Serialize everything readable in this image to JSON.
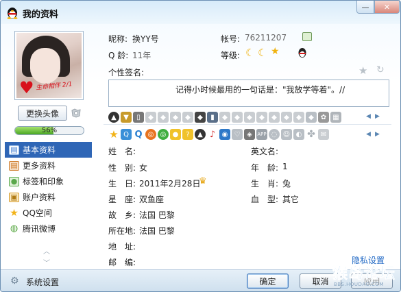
{
  "window": {
    "title": "我的资料",
    "minimize_glyph": "—",
    "close_glyph": "✕"
  },
  "left": {
    "avatar_stamp": "生命相伴 2/1",
    "change_avatar_label": "更换头像",
    "progress": {
      "percent": 56,
      "text": "56%"
    },
    "nav": [
      {
        "label": "基本资料",
        "icon": "profile-card-icon",
        "color": "#3e7bd0"
      },
      {
        "label": "更多资料",
        "icon": "more-info-icon",
        "color": "#d07c2a"
      },
      {
        "label": "标签和印象",
        "icon": "tag-icon",
        "color": "#5aa84b"
      },
      {
        "label": "账户资料",
        "icon": "account-icon",
        "color": "#d59a2a"
      },
      {
        "label": "QQ空间",
        "icon": "qzone-star-icon",
        "color": "#f2b216"
      },
      {
        "label": "腾讯微博",
        "icon": "weibo-icon",
        "color": "#55a63f"
      }
    ],
    "up_glyph": "︿",
    "down_glyph": "﹀"
  },
  "profile": {
    "nickname_label": "昵称:",
    "nickname_value": "换YY号",
    "account_label": "帐号:",
    "account_value": "76211207",
    "age_label": "Q 龄:",
    "age_value": "11年",
    "level_label": "等级:",
    "signature_label": "个性签名:",
    "signature_text": "记得小时候最用的一句话是：\"我放学等着\"。//"
  },
  "details": {
    "left": [
      {
        "label": "姓　名:",
        "value": ""
      },
      {
        "label": "性　别:",
        "value": "女"
      },
      {
        "label": "生　日:",
        "value": "2011年2月28日"
      },
      {
        "label": "星　座:",
        "value": "双鱼座"
      },
      {
        "label": "故　乡:",
        "value": "法国 巴黎"
      },
      {
        "label": "所在地:",
        "value": "法国 巴黎"
      },
      {
        "label": "地　址:",
        "value": ""
      },
      {
        "label": "邮　编:",
        "value": ""
      }
    ],
    "right": [
      {
        "label": "英文名:",
        "value": ""
      },
      {
        "label": "年　龄:",
        "value": "1"
      },
      {
        "label": "生　肖:",
        "value": "兔"
      },
      {
        "label": "血　型:",
        "value": "其它"
      }
    ]
  },
  "privacy_link": "隐私设置",
  "bottom": {
    "settings_label": "系统设置",
    "ok_label": "确定",
    "cancel_label": "取消",
    "apply_label": "应用"
  },
  "watermark": {
    "big": "猴岛论坛",
    "small": "BBS.HOUDAO.COM"
  },
  "colors": {
    "accent": "#2f66b6",
    "link": "#1c66c4",
    "progress": "#4aa723"
  }
}
